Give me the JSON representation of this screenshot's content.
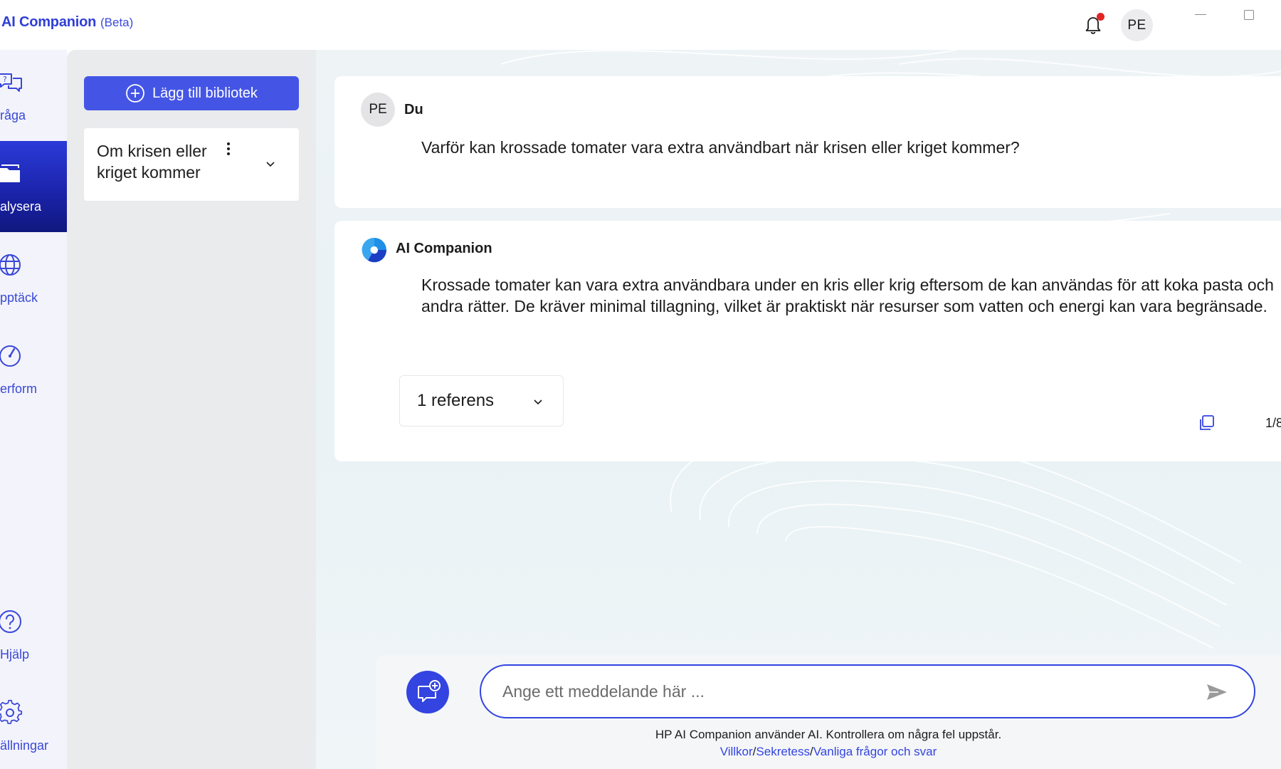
{
  "app": {
    "title": "AI Companion",
    "badge": "(Beta)",
    "user_initials": "PE"
  },
  "nav": {
    "items": [
      {
        "label": "råga",
        "icon": "chat-question-icon",
        "active": false
      },
      {
        "label": "alysera",
        "icon": "folder-icon",
        "active": true
      },
      {
        "label": "pptäck",
        "icon": "globe-icon",
        "active": false
      },
      {
        "label": "erform",
        "icon": "gauge-icon",
        "active": false
      },
      {
        "label": "Hjälp",
        "icon": "help-icon",
        "active": false
      },
      {
        "label": "ällningar",
        "icon": "gear-icon",
        "active": false
      }
    ]
  },
  "library": {
    "add_button_label": "Lägg till bibliotek",
    "items": [
      {
        "title": "Om krisen eller kriget kommer"
      }
    ]
  },
  "conversation": {
    "user": {
      "avatar": "PE",
      "name": "Du",
      "text": "Varför kan krossade tomater vara extra användbart när krisen eller kriget kommer?"
    },
    "assistant": {
      "name": "AI Companion",
      "text": "Krossade tomater kan vara extra användbara under en kris eller krig eftersom de kan användas för att koka pasta och andra rätter. De kräver minimal tillagning, vilket är praktiskt när resurser som vatten och energi kan vara begränsade.",
      "references_label": "1 referens",
      "page_indicator": "1/8"
    }
  },
  "composer": {
    "placeholder": "Ange ett meddelande här ...",
    "disclaimer": "HP AI Companion använder AI. Kontrollera om några fel uppstår.",
    "links": {
      "terms": "Villkor",
      "privacy": "Sekretess",
      "faq": "Vanliga frågor och svar",
      "separator": "/"
    }
  },
  "colors": {
    "accent": "#3344e0",
    "nav_active": "#1a22a8",
    "notification_dot": "#e22424"
  }
}
